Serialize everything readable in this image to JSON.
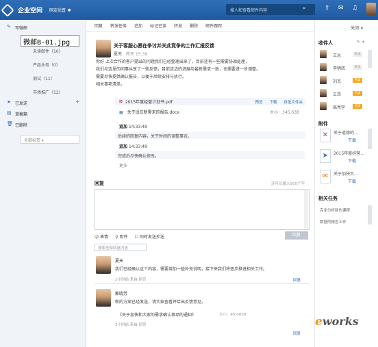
{
  "app": {
    "brand": "企业空间",
    "org": "网友优普"
  },
  "search": {
    "placeholder": "搜人和查看邮件内容"
  },
  "file_label": "微邮B-01.jpg",
  "sidebar": {
    "items": [
      {
        "label": "写微邮"
      },
      {
        "label": "未读邮件（10）"
      },
      {
        "label": "产品业务（0）"
      },
      {
        "label": "测试（11）"
      },
      {
        "label": "市场推广（12）"
      },
      {
        "label": "已发送"
      },
      {
        "label": "草稿箱"
      },
      {
        "label": "已删除"
      }
    ],
    "tag_select": "全部标签"
  },
  "toolbar": [
    "回复",
    "转发任务",
    "追加",
    "标记已读",
    "转发",
    "删除",
    "邮件跟踪"
  ],
  "message": {
    "subject": "关于客服心愿在争讨并关此竞争的工作汇报反馈",
    "sender": "夏天",
    "date": "昨天 15:39",
    "body": [
      "你好 上次合作的客户提出的问题我们已经整理出来了，目前还有一些需要协调处理，",
      "我们与这里的同事共享了一些反馈，目前这边的进展与最新需求一致，也需要进一步调整。",
      "需要尽快提供确认报告，以便于后续安排与执行。",
      "相关事项清单。"
    ],
    "attachment_1": {
      "name": "2015年度经营计划书.pdf",
      "preview": "预览",
      "download": "下载",
      "save": "存至文件夹"
    },
    "attachment_2": {
      "name": "关于适应新需求的报告.docx",
      "size": "大小：345.63B"
    },
    "replies": [
      {
        "user": "追加",
        "time": "14:33:49",
        "text": "后续的回复内容，关于时间的调整事宜。"
      },
      {
        "user": "追加",
        "time": "14:33:49",
        "text": "完成后尽快确认修改。",
        "more": "更多"
      }
    ]
  },
  "reply_section": {
    "title": "回复",
    "limit": "还可以输入500个字",
    "options": [
      "表情",
      "附件",
      "同时发送抄送"
    ],
    "button": "回复",
    "search": "搜索全部回复内容"
  },
  "comments": [
    {
      "name": "夏天",
      "text": "我们已经确认这个内容，需要增加一些补充说明，接下来我们将逐步推进相关工作。",
      "meta": "2小时前  来自  网页",
      "reply": "回复"
    },
    {
      "name": "郭晓芳",
      "text": "新的方案已经发送，请大家查看并给出反馈意见。",
      "attach": "《关于加快和大家的需求确认事项的通知》",
      "size": "大小：45.003B",
      "meta": "3小时前  来自  网页",
      "reply": "回复"
    }
  ],
  "right_panel": {
    "close": "关闭 ✕",
    "recipients_title": "收件人",
    "recipients": [
      {
        "name": "王总",
        "badge": "未读"
      },
      {
        "name": "李明辉",
        "badge": "未读"
      },
      {
        "name": "刘杰",
        "badge": "已读"
      },
      {
        "name": "王昂",
        "badge": "已读"
      },
      {
        "name": "高亮宇",
        "badge": "已读"
      }
    ],
    "attachments_title": "附件",
    "files": [
      {
        "name": "关于道德的…",
        "action": "下载"
      },
      {
        "name": "2015年度经营…",
        "action": "下载"
      },
      {
        "name": "关于加快大…",
        "action": "下载"
      }
    ],
    "tasks_title": "相关任务",
    "tasks": [
      "完全分析新的课程",
      "数据的报告工作"
    ]
  },
  "colors": {
    "topbar": "#2f6fb8",
    "accent": "#f7931e",
    "read_badge": "#f5a623"
  }
}
